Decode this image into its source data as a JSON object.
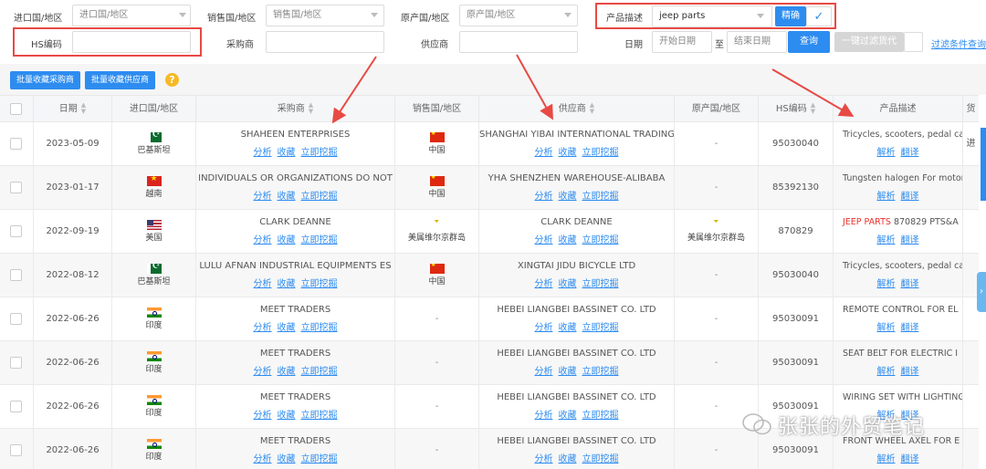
{
  "filters": {
    "import_country_label": "进口国/地区",
    "import_country_placeholder": "进口国/地区",
    "sales_country_label": "销售国/地区",
    "sales_country_placeholder": "销售国/地区",
    "origin_country_label": "原产国/地区",
    "origin_country_placeholder": "原产国/地区",
    "product_desc_label": "产品描述",
    "product_desc_value": "jeep parts",
    "exact_button": "精确",
    "hs_code_label": "HS编码",
    "buyer_label": "采购商",
    "supplier_label": "供应商",
    "date_label": "日期",
    "start_date_placeholder": "开始日期",
    "to_label": "至",
    "end_date_placeholder": "结束日期",
    "search_button": "查询",
    "one_click_filter": "一键过滤货代",
    "filter_search_link": "过滤条件查询"
  },
  "actions": {
    "bulk_fav_buyer": "批量收藏采购商",
    "bulk_fav_supplier": "批量收藏供应商",
    "help": "?"
  },
  "table": {
    "headers": {
      "date": "日期",
      "import_country": "进口国/地区",
      "buyer": "采购商",
      "sales_country": "销售国/地区",
      "supplier": "供应商",
      "origin_country": "原产国/地区",
      "hs_code": "HS编码",
      "product_desc": "产品描述",
      "extra": "货"
    },
    "link_labels": {
      "analyze": "分析",
      "favorite": "收藏",
      "mine": "立即挖掘",
      "parse": "解析",
      "translate": "翻译"
    },
    "rows": [
      {
        "date": "2023-05-09",
        "import_flag": "pk",
        "import_country": "巴基斯坦",
        "buyer": "SHAHEEN ENTERPRISES",
        "sales_flag": "cn",
        "sales_country": "中国",
        "supplier": "SHANGHAI YIBAI INTERNATIONAL TRADING",
        "origin": "-",
        "hs": "95030040",
        "desc_hl": "",
        "desc": "Tricycles, scooters, pedal cars",
        "extra": "进"
      },
      {
        "date": "2023-01-17",
        "import_flag": "vn",
        "import_country": "越南",
        "buyer": "INDIVIDUALS OR ORGANIZATIONS DO NOT",
        "sales_flag": "cn",
        "sales_country": "中国",
        "supplier": "YHA SHENZHEN WAREHOUSE-ALIBABA",
        "origin": "-",
        "hs": "85392130",
        "desc_hl": "",
        "desc": "Tungsten halogen For motor v",
        "extra": ""
      },
      {
        "date": "2022-09-19",
        "import_flag": "us",
        "import_country": "美国",
        "buyer": "CLARK DEANNE",
        "sales_flag": "vi",
        "sales_country": "美属维尔京群岛",
        "supplier": "CLARK DEANNE",
        "origin_flag": "vi",
        "origin": "美属维尔京群岛",
        "hs": "870829",
        "desc_hl": "JEEP PARTS",
        "desc": " 870829 PTS&A",
        "extra": ""
      },
      {
        "date": "2022-08-12",
        "import_flag": "pk",
        "import_country": "巴基斯坦",
        "buyer": "LULU AFNAN INDUSTRIAL EQUIPMENTS ES",
        "sales_flag": "cn",
        "sales_country": "中国",
        "supplier": "XINGTAI JIDU BICYCLE LTD",
        "origin": "-",
        "hs": "95030040",
        "desc_hl": "",
        "desc": "Tricycles, scooters, pedal cars",
        "extra": ""
      },
      {
        "date": "2022-06-26",
        "import_flag": "in",
        "import_country": "印度",
        "buyer": "MEET TRADERS",
        "sales_flag": "",
        "sales_country": "-",
        "supplier": "HEBEI LIANGBEI BASSINET CO. LTD",
        "origin": "-",
        "hs": "95030091",
        "desc_hl": "",
        "desc": "REMOTE CONTROL FOR EL",
        "extra": ""
      },
      {
        "date": "2022-06-26",
        "import_flag": "in",
        "import_country": "印度",
        "buyer": "MEET TRADERS",
        "sales_flag": "",
        "sales_country": "-",
        "supplier": "HEBEI LIANGBEI BASSINET CO. LTD",
        "origin": "-",
        "hs": "95030091",
        "desc_hl": "",
        "desc": "SEAT BELT FOR ELECTRIC I",
        "extra": ""
      },
      {
        "date": "2022-06-26",
        "import_flag": "in",
        "import_country": "印度",
        "buyer": "MEET TRADERS",
        "sales_flag": "",
        "sales_country": "-",
        "supplier": "HEBEI LIANGBEI BASSINET CO. LTD",
        "origin": "-",
        "hs": "95030091",
        "desc_hl": "",
        "desc": "WIRING SET WITH LIGHTING",
        "extra": ""
      },
      {
        "date": "2022-06-26",
        "import_flag": "in",
        "import_country": "印度",
        "buyer": "MEET TRADERS",
        "sales_flag": "",
        "sales_country": "-",
        "supplier": "HEBEI LIANGBEI BASSINET CO. LTD",
        "origin": "-",
        "hs": "95030091",
        "desc_hl": "",
        "desc": "FRONT WHEEL AXEL FOR E",
        "extra": ""
      }
    ]
  },
  "watermark": "张张的外贸笔记",
  "colors": {
    "accent": "#2d8cf0",
    "highlight": "#e8322b",
    "annotation": "#e84a44"
  }
}
